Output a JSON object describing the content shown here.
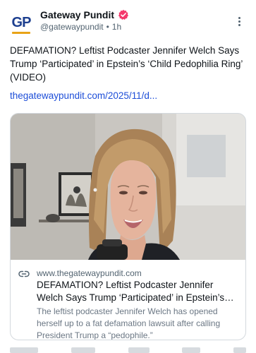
{
  "author": {
    "display_name": "Gateway Pundit",
    "handle": "@gatewaypundit",
    "separator": "•",
    "time": "1h",
    "avatar_text": "GP",
    "verified_color": "#f4386b"
  },
  "post": {
    "text": "DEFAMATION? Leftist Podcaster Jennifer Welch Says Trump ‘Participated’ in Epstein’s ‘Child Pedophilia Ring’ (VIDEO)",
    "link_text": "thegatewaypundit.com/2025/11/d..."
  },
  "card": {
    "domain": "www.thegatewaypundit.com",
    "title": "DEFAMATION? Leftist Podcaster Jennifer Welch Says Trump ‘Participated’ in Epstein’s ‘Child Pedophilia Ring’ (VIDEO)",
    "description": "The leftist podcaster Jennifer Welch has opened herself up to a fat defamation lawsuit after calling President Trump a “pedophile.”"
  },
  "colors": {
    "link": "#1d4ed8",
    "brand_blue": "#1d3f8f",
    "brand_accent": "#e8a317"
  }
}
